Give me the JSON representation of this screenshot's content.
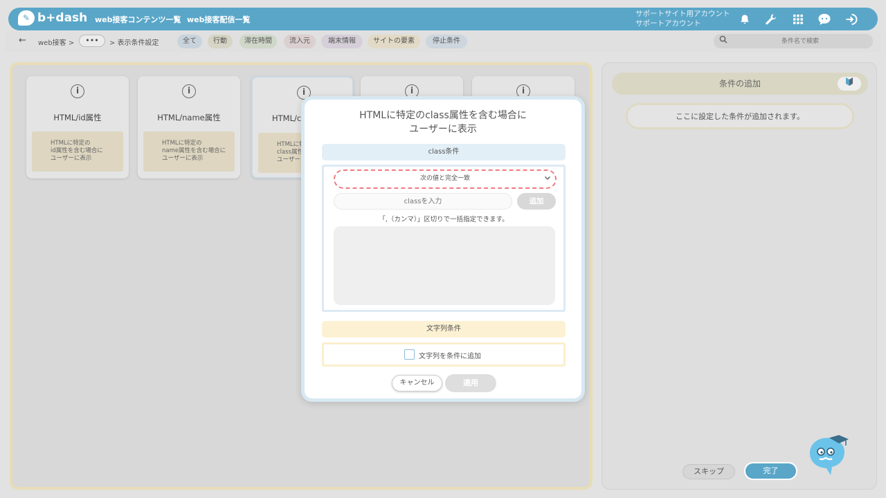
{
  "header": {
    "logo_text": "b+dash",
    "nav": [
      "web接客コンテンツ一覧",
      "web接客配信一覧"
    ],
    "account_line1": "サポートサイト用アカウント",
    "account_line2": "サポートアカウント",
    "icons": [
      "bell-icon",
      "wrench-icon",
      "grid-icon",
      "chat-icon",
      "logout-icon"
    ]
  },
  "breadcrumb": {
    "items": [
      "web接客 >",
      "•••",
      "> 表示条件設定"
    ]
  },
  "filters": [
    {
      "label": "全て",
      "color": "#c9d3dc"
    },
    {
      "label": "行動",
      "color": "#d6d4c4"
    },
    {
      "label": "滞在時間",
      "color": "#cfd7c9"
    },
    {
      "label": "流入元",
      "color": "#dccfcf"
    },
    {
      "label": "端末情報",
      "color": "#d6cfd9"
    },
    {
      "label": "サイトの要素",
      "color": "#e2dac6"
    },
    {
      "label": "停止条件",
      "color": "#cdd6de"
    }
  ],
  "search": {
    "placeholder": "条件名で検索"
  },
  "cards": [
    {
      "title": "HTML/id属性",
      "desc": [
        "HTMLに特定の",
        "id属性を含む場合に",
        "ユーザーに表示"
      ]
    },
    {
      "title": "HTML/name属性",
      "desc": [
        "HTMLに特定の",
        "name属性を含む場合に",
        "ユーザーに表示"
      ]
    },
    {
      "title": "HTML/c",
      "desc": [
        "HTMLに特定",
        "class属性を",
        "ユーザーに"
      ]
    }
  ],
  "right_panel": {
    "title": "条件の追加",
    "placeholder": "ここに設定した条件が追加されます。",
    "skip": "スキップ",
    "done": "完了"
  },
  "modal": {
    "title_line1": "HTMLに特定のclass属性を含む場合に",
    "title_line2": "ユーザーに表示",
    "class_section": "class条件",
    "match_select": "次の値と完全一致",
    "class_input_placeholder": "classを入力",
    "add_button": "追加",
    "hint": "「,（カンマ）」区切りで一括指定できます。",
    "string_section": "文字列条件",
    "string_checkbox": "文字列を条件に追加",
    "cancel": "キャンセル",
    "apply": "適用"
  },
  "colors": {
    "brand": "#5aa6c8",
    "dashed_highlight": "#f07a80"
  }
}
